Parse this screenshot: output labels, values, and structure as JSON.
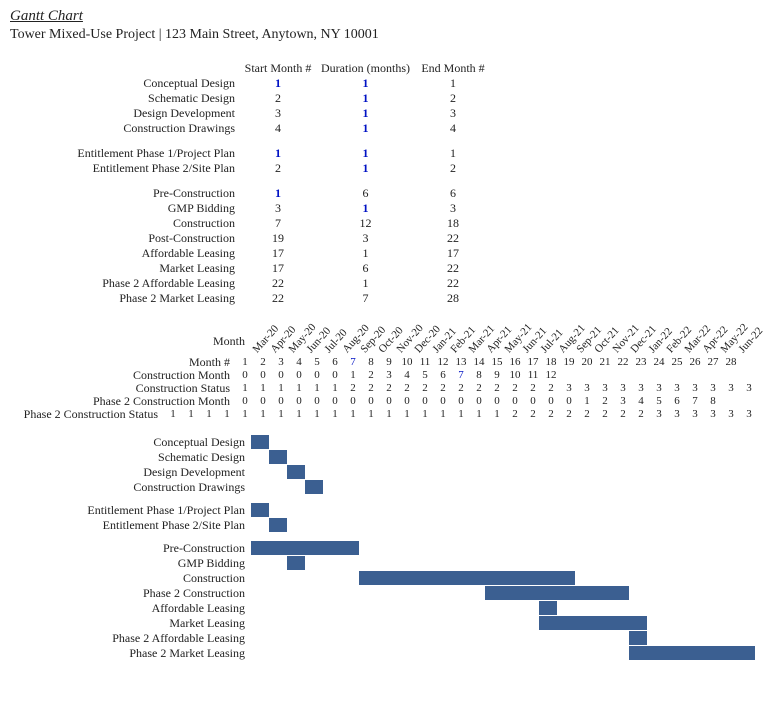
{
  "title": "Gantt Chart",
  "subtitle": "Tower Mixed-Use Project | 123 Main Street, Anytown, NY 10001",
  "col_headers": {
    "start": "Start Month #",
    "duration": "Duration (months)",
    "end": "End Month #"
  },
  "groups": [
    [
      {
        "name": "Conceptual Design",
        "start": 1,
        "start_hl": true,
        "duration": 1,
        "dur_hl": true,
        "end": 1
      },
      {
        "name": "Schematic Design",
        "start": 2,
        "duration": 1,
        "dur_hl": true,
        "end": 2
      },
      {
        "name": "Design Development",
        "start": 3,
        "duration": 1,
        "dur_hl": true,
        "end": 3
      },
      {
        "name": "Construction Drawings",
        "start": 4,
        "duration": 1,
        "dur_hl": true,
        "end": 4
      }
    ],
    [
      {
        "name": "Entitlement Phase 1/Project Plan",
        "start": 1,
        "start_hl": true,
        "duration": 1,
        "dur_hl": true,
        "end": 1
      },
      {
        "name": "Entitlement Phase 2/Site Plan",
        "start": 2,
        "duration": 1,
        "dur_hl": true,
        "end": 2
      }
    ],
    [
      {
        "name": "Pre-Construction",
        "start": 1,
        "start_hl": true,
        "duration": 6,
        "end": 6
      },
      {
        "name": "GMP Bidding",
        "start": 3,
        "duration": 1,
        "dur_hl": true,
        "end": 3
      },
      {
        "name": "Construction",
        "start": 7,
        "duration": 12,
        "end": 18
      },
      {
        "name": "Post-Construction",
        "start": 19,
        "duration": 3,
        "end": 22
      },
      {
        "name": "Affordable Leasing",
        "start": 17,
        "duration": 1,
        "end": 17
      },
      {
        "name": "Market Leasing",
        "start": 17,
        "duration": 6,
        "end": 22
      },
      {
        "name": "Phase 2 Affordable Leasing",
        "start": 22,
        "duration": 1,
        "end": 22
      },
      {
        "name": "Phase 2 Market Leasing",
        "start": 22,
        "duration": 7,
        "end": 28
      }
    ]
  ],
  "timeline": {
    "months": [
      "Mar-20",
      "Apr-20",
      "May-20",
      "Jun-20",
      "Jul-20",
      "Aug-20",
      "Sep-20",
      "Oct-20",
      "Nov-20",
      "Dec-20",
      "Jan-21",
      "Feb-21",
      "Mar-21",
      "Apr-21",
      "May-21",
      "Jun-21",
      "Jul-21",
      "Aug-21",
      "Sep-21",
      "Oct-21",
      "Nov-21",
      "Dec-21",
      "Jan-22",
      "Feb-22",
      "Mar-22",
      "Apr-22",
      "May-22",
      "Jun-22"
    ],
    "rows": [
      {
        "label": "Month",
        "type": "months"
      },
      {
        "label": "Month #",
        "values": [
          1,
          2,
          3,
          4,
          5,
          6,
          7,
          8,
          9,
          10,
          11,
          12,
          13,
          14,
          15,
          16,
          17,
          18,
          19,
          20,
          21,
          22,
          23,
          24,
          25,
          26,
          27,
          28,
          ""
        ],
        "hl": [
          6
        ]
      },
      {
        "label": "Construction Month",
        "values": [
          0,
          0,
          0,
          0,
          0,
          0,
          1,
          2,
          3,
          4,
          5,
          6,
          7,
          8,
          9,
          10,
          11,
          12,
          "",
          "",
          "",
          "",
          "",
          "",
          "",
          "",
          "",
          "",
          ""
        ],
        "hl": [
          12
        ]
      },
      {
        "label": "Construction Status",
        "values": [
          1,
          1,
          1,
          1,
          1,
          1,
          2,
          2,
          2,
          2,
          2,
          2,
          2,
          2,
          2,
          2,
          2,
          2,
          3,
          3,
          3,
          3,
          3,
          3,
          3,
          3,
          3,
          3,
          3
        ]
      },
      {
        "label": "Phase 2 Construction Month",
        "values": [
          0,
          0,
          0,
          0,
          0,
          0,
          0,
          0,
          0,
          0,
          0,
          0,
          0,
          0,
          0,
          0,
          0,
          0,
          0,
          1,
          2,
          3,
          4,
          5,
          6,
          7,
          8,
          "",
          ""
        ]
      },
      {
        "label": "Phase 2 Construction Status",
        "values": [
          1,
          1,
          1,
          1,
          1,
          1,
          1,
          1,
          1,
          1,
          1,
          1,
          1,
          1,
          1,
          1,
          1,
          1,
          1,
          2,
          2,
          2,
          2,
          2,
          2,
          2,
          2,
          3,
          3,
          3,
          3,
          3,
          3
        ]
      }
    ]
  },
  "chart_data": {
    "type": "bar",
    "title": "Gantt Chart",
    "xlabel": "Month #",
    "ylabel": "",
    "x_range": [
      1,
      28
    ],
    "bars": [
      {
        "name": "Conceptual Design",
        "start": 1,
        "duration": 1
      },
      {
        "name": "Schematic Design",
        "start": 2,
        "duration": 1
      },
      {
        "name": "Design Development",
        "start": 3,
        "duration": 1
      },
      {
        "name": "Construction Drawings",
        "start": 4,
        "duration": 1
      },
      {
        "name": "Entitlement Phase 1/Project Plan",
        "start": 1,
        "duration": 1
      },
      {
        "name": "Entitlement Phase 2/Site Plan",
        "start": 2,
        "duration": 1
      },
      {
        "name": "Pre-Construction",
        "start": 1,
        "duration": 6
      },
      {
        "name": "GMP Bidding",
        "start": 3,
        "duration": 1
      },
      {
        "name": "Construction",
        "start": 7,
        "duration": 12
      },
      {
        "name": "Phase 2 Construction",
        "start": 14,
        "duration": 8
      },
      {
        "name": "Affordable Leasing",
        "start": 17,
        "duration": 1
      },
      {
        "name": "Market Leasing",
        "start": 17,
        "duration": 6
      },
      {
        "name": "Phase 2 Affordable Leasing",
        "start": 22,
        "duration": 1
      },
      {
        "name": "Phase 2 Market Leasing",
        "start": 22,
        "duration": 7
      }
    ],
    "gantt_gap_after": [
      3,
      5
    ]
  }
}
